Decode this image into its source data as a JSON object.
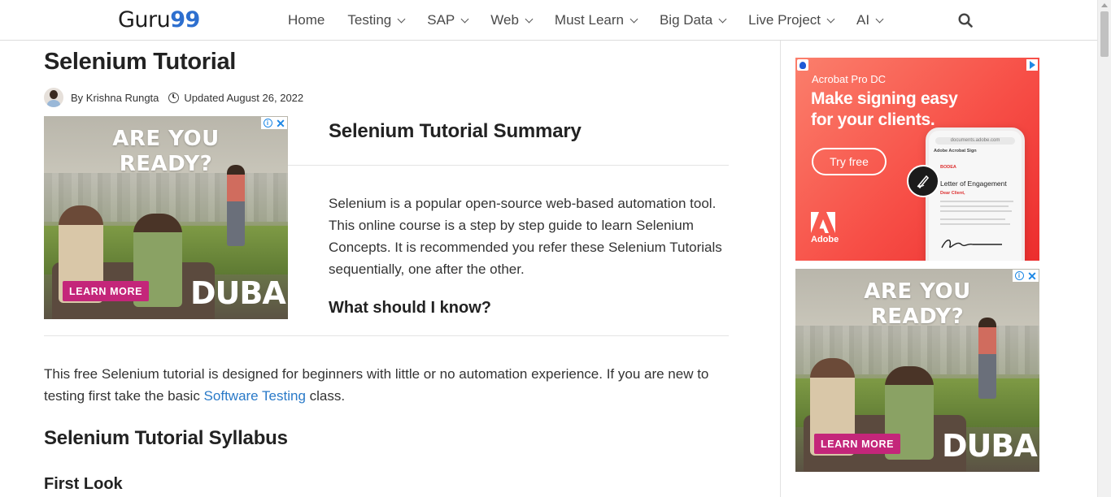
{
  "brand": {
    "name": "Guru",
    "accent": "99"
  },
  "nav": [
    {
      "label": "Home",
      "dropdown": false
    },
    {
      "label": "Testing",
      "dropdown": true
    },
    {
      "label": "SAP",
      "dropdown": true
    },
    {
      "label": "Web",
      "dropdown": true
    },
    {
      "label": "Must Learn",
      "dropdown": true
    },
    {
      "label": "Big Data",
      "dropdown": true
    },
    {
      "label": "Live Project",
      "dropdown": true
    },
    {
      "label": "AI",
      "dropdown": true
    }
  ],
  "article": {
    "title": "Selenium Tutorial",
    "author": "By Krishna Rungta",
    "updated": "Updated August 26, 2022",
    "summary_heading": "Selenium Tutorial Summary",
    "summary_text": "Selenium is a popular open-source web-based automation tool. This online course is a step by step guide to learn Selenium Concepts. It is recommended you refer these Selenium Tutorials sequentially, one after the other.",
    "know_heading": "What should I know?",
    "intro_before_link": "This free Selenium tutorial is designed for beginners with little or no automation experience. If you are new to testing first take the basic ",
    "intro_link": "Software Testing",
    "intro_after_link": " class.",
    "syllabus_heading": "Selenium Tutorial Syllabus",
    "first_look_heading": "First Look"
  },
  "ads": {
    "dubai": {
      "line1": "ARE YOU",
      "line2": "READY?",
      "cta": "LEARN MORE",
      "logo": "DUBAI"
    },
    "adobe": {
      "product": "Acrobat Pro DC",
      "tagline": "Make signing easy for your clients.",
      "cta": "Try free",
      "brand": "Adobe",
      "phone_url": "documents.adobe.com",
      "phone_app": "Adobe Acrobat Sign",
      "doc_brand": "BODEA",
      "doc_title": "Letter of Engagement",
      "doc_greeting": "Dear Client,"
    }
  },
  "colors": {
    "brand_accent": "#2d6fcf",
    "link": "#2a7ac8",
    "cta_pink": "#c4267a",
    "adobe_red": "#f74f47"
  }
}
